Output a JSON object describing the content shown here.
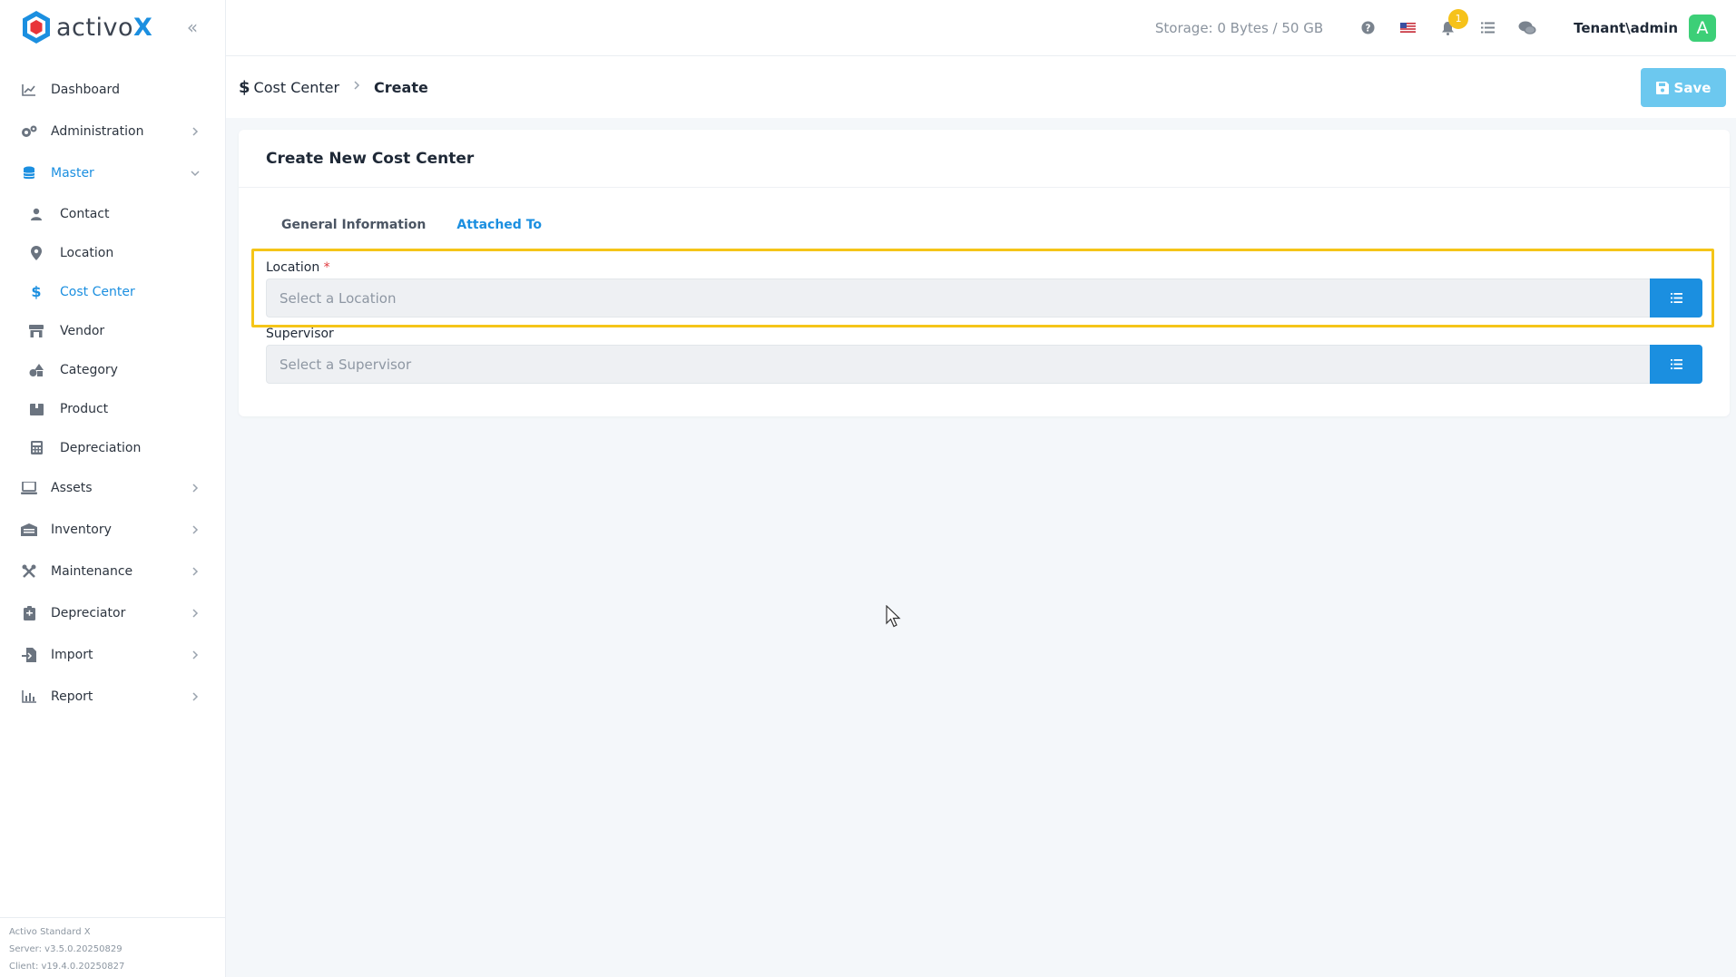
{
  "brand": {
    "name_main": "activo",
    "name_accent": "X",
    "accent_color": "#1b8fe0"
  },
  "sidebar": {
    "items": [
      {
        "label": "Dashboard",
        "icon": "chart-line-icon"
      },
      {
        "label": "Administration",
        "icon": "cogs-icon"
      },
      {
        "label": "Master",
        "icon": "database-icon"
      },
      {
        "label": "Assets",
        "icon": "laptop-icon"
      },
      {
        "label": "Inventory",
        "icon": "warehouse-icon"
      },
      {
        "label": "Maintenance",
        "icon": "tools-icon"
      },
      {
        "label": "Depreciator",
        "icon": "calculator-clipboard-icon"
      },
      {
        "label": "Import",
        "icon": "file-import-icon"
      },
      {
        "label": "Report",
        "icon": "chart-bar-icon"
      }
    ],
    "master_sub": [
      {
        "label": "Contact",
        "icon": "user-icon"
      },
      {
        "label": "Location",
        "icon": "map-pin-icon"
      },
      {
        "label": "Cost Center",
        "icon": "dollar-icon"
      },
      {
        "label": "Vendor",
        "icon": "store-icon"
      },
      {
        "label": "Category",
        "icon": "shapes-icon"
      },
      {
        "label": "Product",
        "icon": "box-icon"
      },
      {
        "label": "Depreciation",
        "icon": "calculator-icon"
      }
    ],
    "version": {
      "product": "Activo Standard X",
      "server": "Server: v3.5.0.20250829",
      "client": "Client: v19.4.0.20250827"
    }
  },
  "topbar": {
    "storage": "Storage: 0 Bytes / 50 GB",
    "notification_count": "1",
    "user": "Tenant\\admin",
    "avatar_letter": "A"
  },
  "breadcrumb": {
    "parent": "Cost Center",
    "current": "Create"
  },
  "actions": {
    "save_label": "Save"
  },
  "form": {
    "title": "Create New Cost Center",
    "tabs": [
      "General Information",
      "Attached To"
    ],
    "location": {
      "label": "Location",
      "required_mark": "*",
      "placeholder": "Select a Location"
    },
    "supervisor": {
      "label": "Supervisor",
      "placeholder": "Select a Supervisor"
    }
  }
}
